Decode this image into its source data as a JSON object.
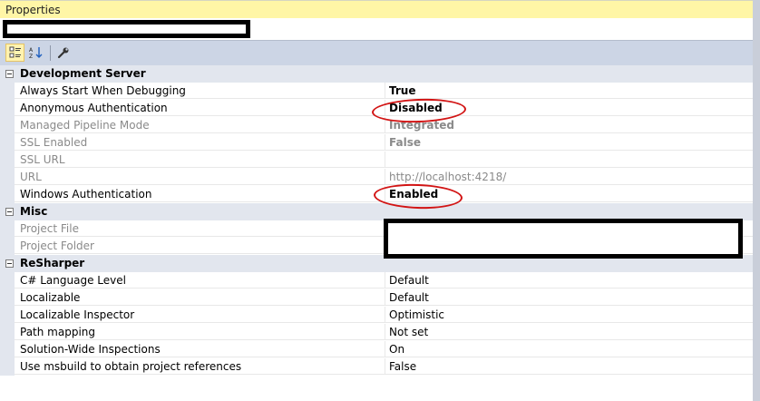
{
  "window": {
    "title": "Properties"
  },
  "toolbar": {
    "categorized_icon": "categorized-icon",
    "alphabetical_icon": "alphabetical-sort-icon",
    "property_pages_icon": "wrench-icon"
  },
  "categories": [
    {
      "name": "Development Server",
      "rows": [
        {
          "name": "Always Start When Debugging",
          "value": "True"
        },
        {
          "name": "Anonymous Authentication",
          "value": "Disabled"
        },
        {
          "name": "Managed Pipeline Mode",
          "value": "Integrated"
        },
        {
          "name": "SSL Enabled",
          "value": "False"
        },
        {
          "name": "SSL URL",
          "value": ""
        },
        {
          "name": "URL",
          "value": "http://localhost:4218/"
        },
        {
          "name": "Windows Authentication",
          "value": "Enabled"
        }
      ]
    },
    {
      "name": "Misc",
      "rows": [
        {
          "name": "Project File",
          "value": ""
        },
        {
          "name": "Project Folder",
          "value": ""
        }
      ]
    },
    {
      "name": "ReSharper",
      "rows": [
        {
          "name": "C# Language Level",
          "value": "Default"
        },
        {
          "name": "Localizable",
          "value": "Default"
        },
        {
          "name": "Localizable Inspector",
          "value": "Optimistic"
        },
        {
          "name": "Path mapping",
          "value": "Not set"
        },
        {
          "name": "Solution-Wide Inspections",
          "value": "On"
        },
        {
          "name": "Use msbuild to obtain project references",
          "value": "False"
        }
      ]
    }
  ],
  "colors": {
    "annotation": "#d21414",
    "title_bg": "#fff6a6",
    "category_bg": "#e2e6ee"
  }
}
